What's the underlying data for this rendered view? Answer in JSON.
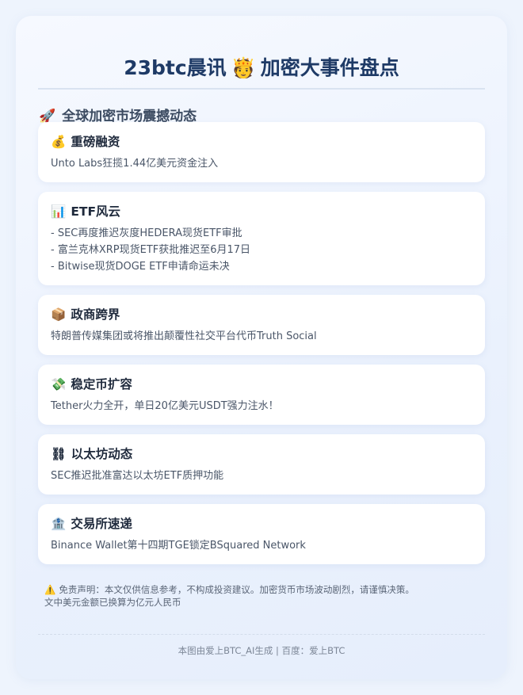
{
  "header": {
    "title_before": "23btc晨讯",
    "title_icon": "🫅",
    "title_after": "加密大事件盘点"
  },
  "section": {
    "icon": "🚀",
    "heading": "全球加密市场震撼动态"
  },
  "news": [
    {
      "icon": "💰",
      "title": "重磅融资",
      "lines": [
        "Unto Labs狂揽1.44亿美元资金注入"
      ]
    },
    {
      "icon": "📊",
      "title": "ETF风云",
      "lines": [
        "- SEC再度推迟灰度HEDERA现货ETF审批",
        "- 富兰克林XRP现货ETF获批推迟至6月17日",
        "- Bitwise现货DOGE ETF申请命运未决"
      ]
    },
    {
      "icon": "📦",
      "title": "政商跨界",
      "lines": [
        "特朗普传媒集团或将推出颠覆性社交平台代币Truth Social"
      ]
    },
    {
      "icon": "💸",
      "title": "稳定币扩容",
      "lines": [
        "Tether火力全开，单日20亿美元USDT强力注水！"
      ]
    },
    {
      "icon": "⛓",
      "title": "以太坊动态",
      "lines": [
        "SEC推迟批准富达以太坊ETF质押功能"
      ]
    },
    {
      "icon": "🏦",
      "title": "交易所速递",
      "lines": [
        "Binance Wallet第十四期TGE锁定BSquared Network"
      ]
    }
  ],
  "disclaimer": {
    "icon": "⚠️",
    "line1": "免责声明：本文仅供信息参考，不构成投资建议。加密货币市场波动剧烈，请谨慎决策。",
    "line2": "文中美元金额已换算为亿元人民币"
  },
  "footer": {
    "text": "本图由爱上BTC_AI生成 | 百度：爱上BTC"
  }
}
